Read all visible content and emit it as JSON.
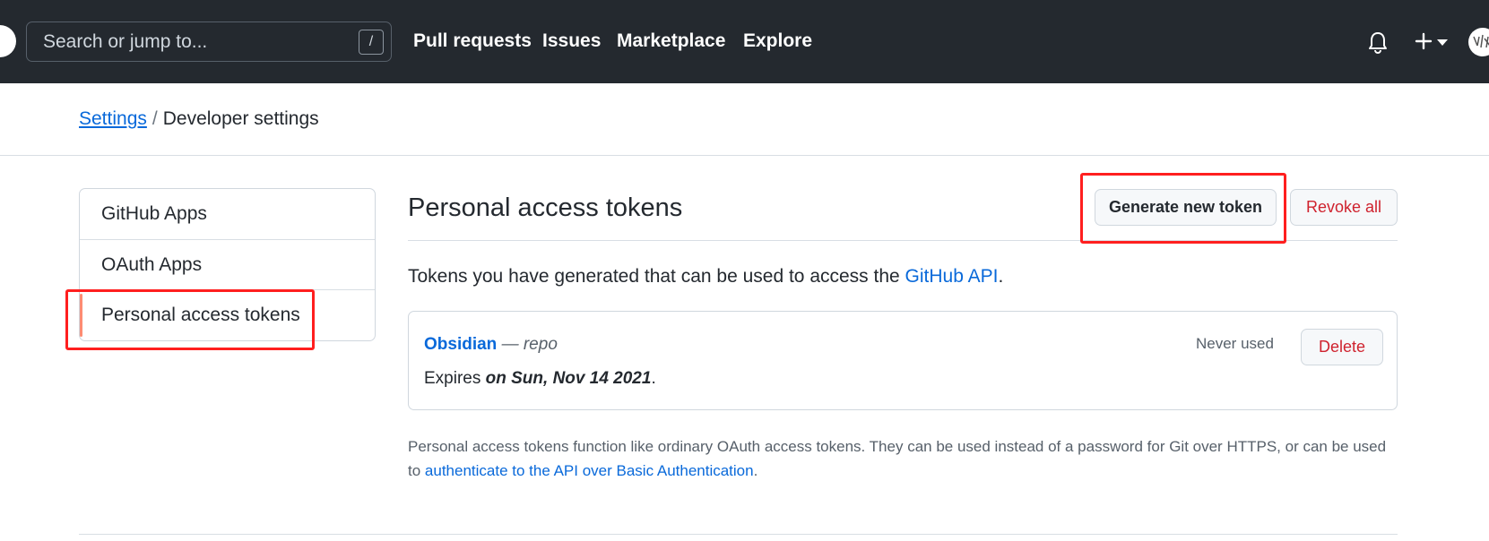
{
  "header": {
    "search_placeholder": "Search or jump to...",
    "search_shortcut": "/",
    "nav": [
      "Pull requests",
      "Issues",
      "Marketplace",
      "Explore"
    ],
    "icons": [
      "bell-icon",
      "plus-icon",
      "caret-down-icon",
      "avatar"
    ],
    "bg_color": "#24292f"
  },
  "breadcrumb": {
    "parent": "Settings",
    "separator": "/",
    "current": "Developer settings"
  },
  "sidebar": {
    "items": [
      {
        "label": "GitHub Apps"
      },
      {
        "label": "OAuth Apps"
      },
      {
        "label": "Personal access tokens",
        "active": true
      }
    ]
  },
  "main": {
    "title": "Personal access tokens",
    "generate_label": "Generate new token",
    "revoke_label": "Revoke all",
    "intro_prefix": "Tokens you have generated that can be used to access the ",
    "intro_link": "GitHub API",
    "intro_suffix": ".",
    "token": {
      "name": "Obsidian",
      "dash": " — ",
      "scope": "repo",
      "expires_prefix": "Expires ",
      "expires_date": "on Sun, Nov 14 2021",
      "expires_suffix": ".",
      "last_used": "Never used",
      "delete_label": "Delete"
    },
    "footnote_text": "Personal access tokens function like ordinary OAuth access tokens. They can be used instead of a password for Git over HTTPS, or can be used to ",
    "footnote_link": "authenticate to the API over Basic Authentication",
    "footnote_suffix": "."
  },
  "colors": {
    "link": "#0969da",
    "danger": "#cf222e",
    "highlight_box": "#ff1f1f",
    "active_marker": "#fd8c73"
  }
}
